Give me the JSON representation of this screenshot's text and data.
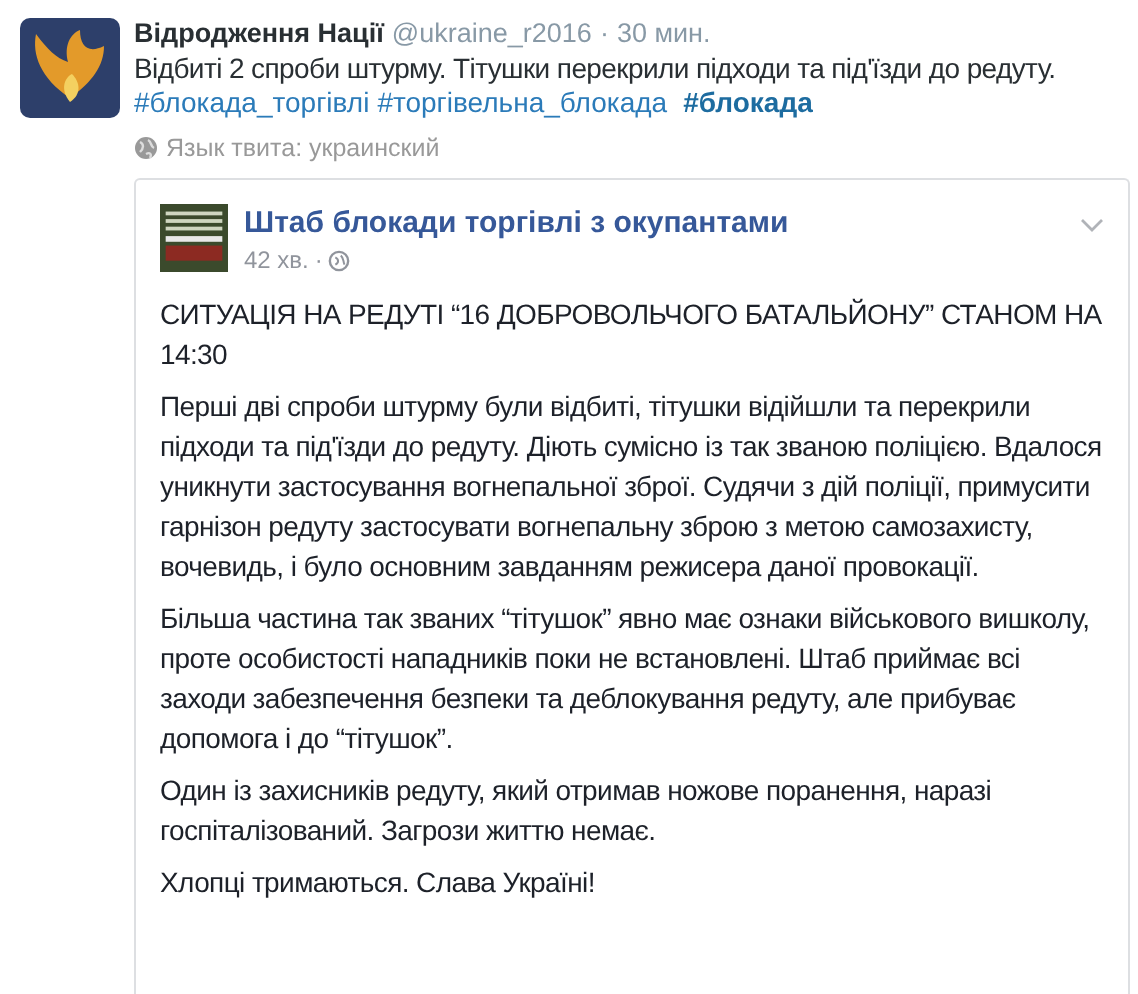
{
  "tweet": {
    "author": "Відродження Нації",
    "handle": "@ukraine_r2016",
    "time": "30 мин.",
    "time_separator": "·",
    "text": "Відбиті 2 спроби штурму. Тітушки перекрили підходи та під'їзди до редуту.",
    "hashtags": [
      {
        "text": "#блокада_торгівлі",
        "bold": false
      },
      {
        "text": "#торгівельна_блокада",
        "bold": false
      },
      {
        "text": "#блокада",
        "bold": true
      }
    ],
    "language": "Язык твита: украинский"
  },
  "post": {
    "page_name": "Штаб блокади торгівлі з окупантами",
    "time": "42 хв.",
    "separator": "·",
    "heading": "СИТУАЦІЯ НА РЕДУТІ “16 ДОБРОВОЛЬЧОГО БАТАЛЬЙОНУ” СТАНОМ НА 14:30",
    "paragraphs": [
      "Перші дві спроби штурму були відбиті, тітушки відійшли та перекрили підходи та під'їзди до редуту. Діють сумісно із так званою поліцією. Вдалося уникнути застосування вогнепальної зброї. Судячи з дій поліції, примусити гарнізон редуту застосувати вогнепальну зброю з метою самозахисту, вочевидь, і було основним завданням режисера даної провокації.",
      "Більша частина так званих “тітушок” явно має ознаки військового вишколу, проте особистості нападників поки не встановлені. Штаб приймає всі заходи забезпечення безпеки та деблокування редуту, але прибуває допомога і до “тітушок”.",
      "Один із захисників редуту, який отримав ножове поранення, наразі госпіталізований. Загрози життю немає.",
      "Хлопці тримаються. Слава Україні!"
    ]
  }
}
